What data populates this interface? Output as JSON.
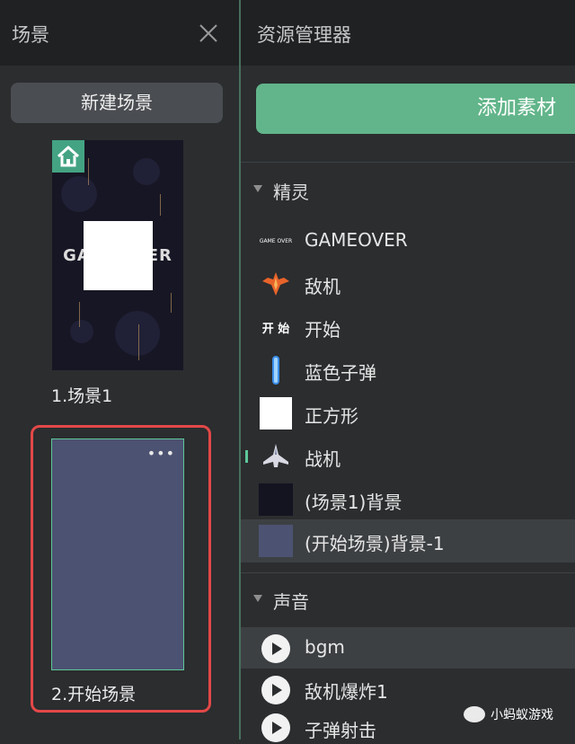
{
  "scenes_panel": {
    "title": "场景",
    "new_scene_label": "新建场景",
    "scenes": [
      {
        "label": "1.场景1",
        "thumbnail_text": "GAMEOVER",
        "is_home": true
      },
      {
        "label": "2.开始场景",
        "more_glyph": "•••",
        "selected": true
      }
    ]
  },
  "asset_panel": {
    "title": "资源管理器",
    "add_asset_label": "添加素材",
    "sprites_section": {
      "title": "精灵",
      "items": [
        {
          "label": "GAMEOVER",
          "icon": "gameover-text-icon",
          "icon_text": "GAME OVER"
        },
        {
          "label": "敌机",
          "icon": "enemy-plane-icon"
        },
        {
          "label": "开始",
          "icon": "start-text-icon",
          "icon_text": "开 始"
        },
        {
          "label": "蓝色子弹",
          "icon": "blue-bullet-icon"
        },
        {
          "label": "正方形",
          "icon": "white-square-icon"
        },
        {
          "label": "战机",
          "icon": "fighter-jet-icon"
        },
        {
          "label": "(场景1)背景",
          "icon": "dark-background-icon"
        },
        {
          "label": "(开始场景)背景-1",
          "icon": "blue-background-icon",
          "selected": true
        }
      ]
    },
    "sounds_section": {
      "title": "声音",
      "items": [
        {
          "label": "bgm",
          "icon": "play-icon",
          "selected": true
        },
        {
          "label": "敌机爆炸1",
          "icon": "play-icon"
        },
        {
          "label": "子弹射击",
          "icon": "play-icon"
        }
      ]
    }
  },
  "watermark": {
    "text": "小蚂蚁游戏"
  },
  "colors": {
    "accent_green": "#62b58a",
    "selection_red": "#e34848",
    "home_badge": "#43a383",
    "scene2_bg": "#4c5271"
  }
}
